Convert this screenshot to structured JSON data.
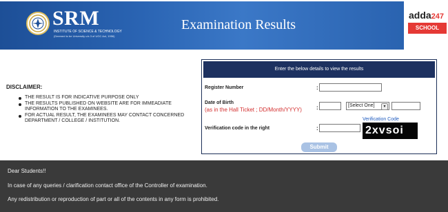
{
  "header": {
    "logo_name": "SRM",
    "logo_subtitle": "INSTITUTE OF SCIENCE & TECHNOLOGY",
    "logo_tagline": "(Deemed to be University u/s 3 of UGC Act, 1956)",
    "title": "Examination Results",
    "banner_color": "#2a63b0"
  },
  "adda": {
    "brand": "adda",
    "brand_suffix": "247",
    "school": "SCHOOL",
    "accent": "#e53935"
  },
  "disclaimer": {
    "title": "DISCLAIMER:",
    "items": [
      "THE RESULT IS FOR INDICATIVE PURPOSE ONLY",
      "THE RESULTS PUBLISHED ON WEBSITE ARE FOR IMMEADIATE INFORMATION TO THE EXAMINEES.",
      "FOR ACTUAL RESULT, THE EXAMINEES MAY CONTACT CONCERNED DEPARTMENT / COLLEGE / INSTITUTION."
    ]
  },
  "form": {
    "heading": "Enter the below details to view the results",
    "register_label": "Register Number",
    "register_value": "",
    "dob_label": "Date of Birth",
    "dob_hint": "(as in the Hall Ticket ; DD/Month/YYYY)",
    "dob_day": "",
    "dob_month_selected": "[Select One]",
    "dob_year": "",
    "verification_label": "Verification code in the right",
    "verification_value": "",
    "verification_link": "Verification Code",
    "captcha_text": "2xvsoi",
    "submit_label": "Submit",
    "colon": ":"
  },
  "footer": {
    "greeting": "Dear Students!!",
    "line1": "In case of any queries / clarification contact office of the Controller of examination.",
    "line2": "Any redistribution or reproduction of part or all of the contents in any form is prohibited."
  }
}
